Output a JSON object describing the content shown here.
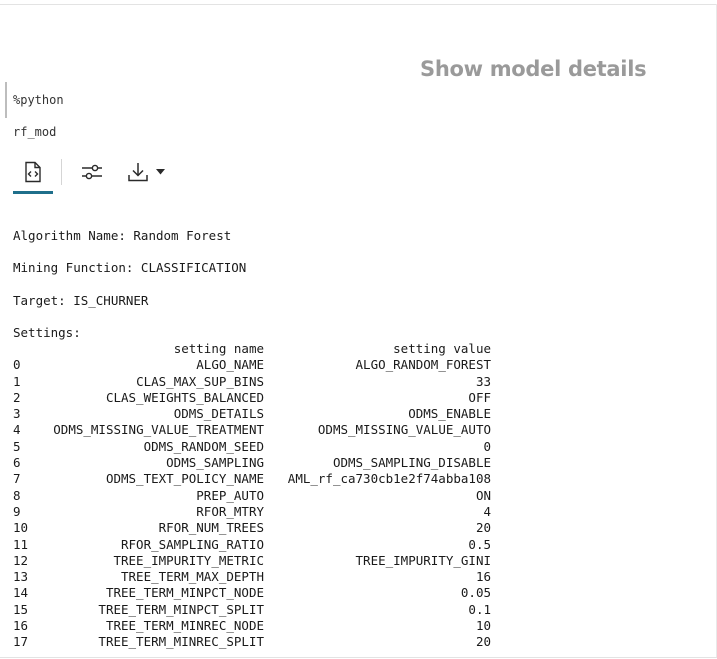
{
  "heading": "Show model details",
  "code": {
    "lines": [
      "%python",
      "rf_mod"
    ]
  },
  "toolbar": {
    "buttons": [
      {
        "name": "code-output-tab",
        "icon": "code-file-icon",
        "active": true
      },
      {
        "name": "settings-tab",
        "icon": "sliders-icon",
        "active": false
      },
      {
        "name": "download-dropdown",
        "icon": "download-icon",
        "active": false
      }
    ],
    "accent_color": "#1f6f8b"
  },
  "output": {
    "algorithm": "Algorithm Name: Random Forest",
    "mining_function": "Mining Function: CLASSIFICATION",
    "target": "Target: IS_CHURNER",
    "settings_label": "Settings:",
    "columns": [
      "setting name",
      "setting value"
    ],
    "rows": [
      {
        "idx": "0",
        "name": "ALGO_NAME",
        "value": "ALGO_RANDOM_FOREST"
      },
      {
        "idx": "1",
        "name": "CLAS_MAX_SUP_BINS",
        "value": "33"
      },
      {
        "idx": "2",
        "name": "CLAS_WEIGHTS_BALANCED",
        "value": "OFF"
      },
      {
        "idx": "3",
        "name": "ODMS_DETAILS",
        "value": "ODMS_ENABLE"
      },
      {
        "idx": "4",
        "name": "ODMS_MISSING_VALUE_TREATMENT",
        "value": "ODMS_MISSING_VALUE_AUTO"
      },
      {
        "idx": "5",
        "name": "ODMS_RANDOM_SEED",
        "value": "0"
      },
      {
        "idx": "6",
        "name": "ODMS_SAMPLING",
        "value": "ODMS_SAMPLING_DISABLE"
      },
      {
        "idx": "7",
        "name": "ODMS_TEXT_POLICY_NAME",
        "value": "AML_rf_ca730cb1e2f74abba108"
      },
      {
        "idx": "8",
        "name": "PREP_AUTO",
        "value": "ON"
      },
      {
        "idx": "9",
        "name": "RFOR_MTRY",
        "value": "4"
      },
      {
        "idx": "10",
        "name": "RFOR_NUM_TREES",
        "value": "20"
      },
      {
        "idx": "11",
        "name": "RFOR_SAMPLING_RATIO",
        "value": "0.5"
      },
      {
        "idx": "12",
        "name": "TREE_IMPURITY_METRIC",
        "value": "TREE_IMPURITY_GINI"
      },
      {
        "idx": "13",
        "name": "TREE_TERM_MAX_DEPTH",
        "value": "16"
      },
      {
        "idx": "14",
        "name": "TREE_TERM_MINPCT_NODE",
        "value": "0.05"
      },
      {
        "idx": "15",
        "name": "TREE_TERM_MINPCT_SPLIT",
        "value": "0.1"
      },
      {
        "idx": "16",
        "name": "TREE_TERM_MINREC_NODE",
        "value": "10"
      },
      {
        "idx": "17",
        "name": "TREE_TERM_MINREC_SPLIT",
        "value": "20"
      }
    ]
  }
}
